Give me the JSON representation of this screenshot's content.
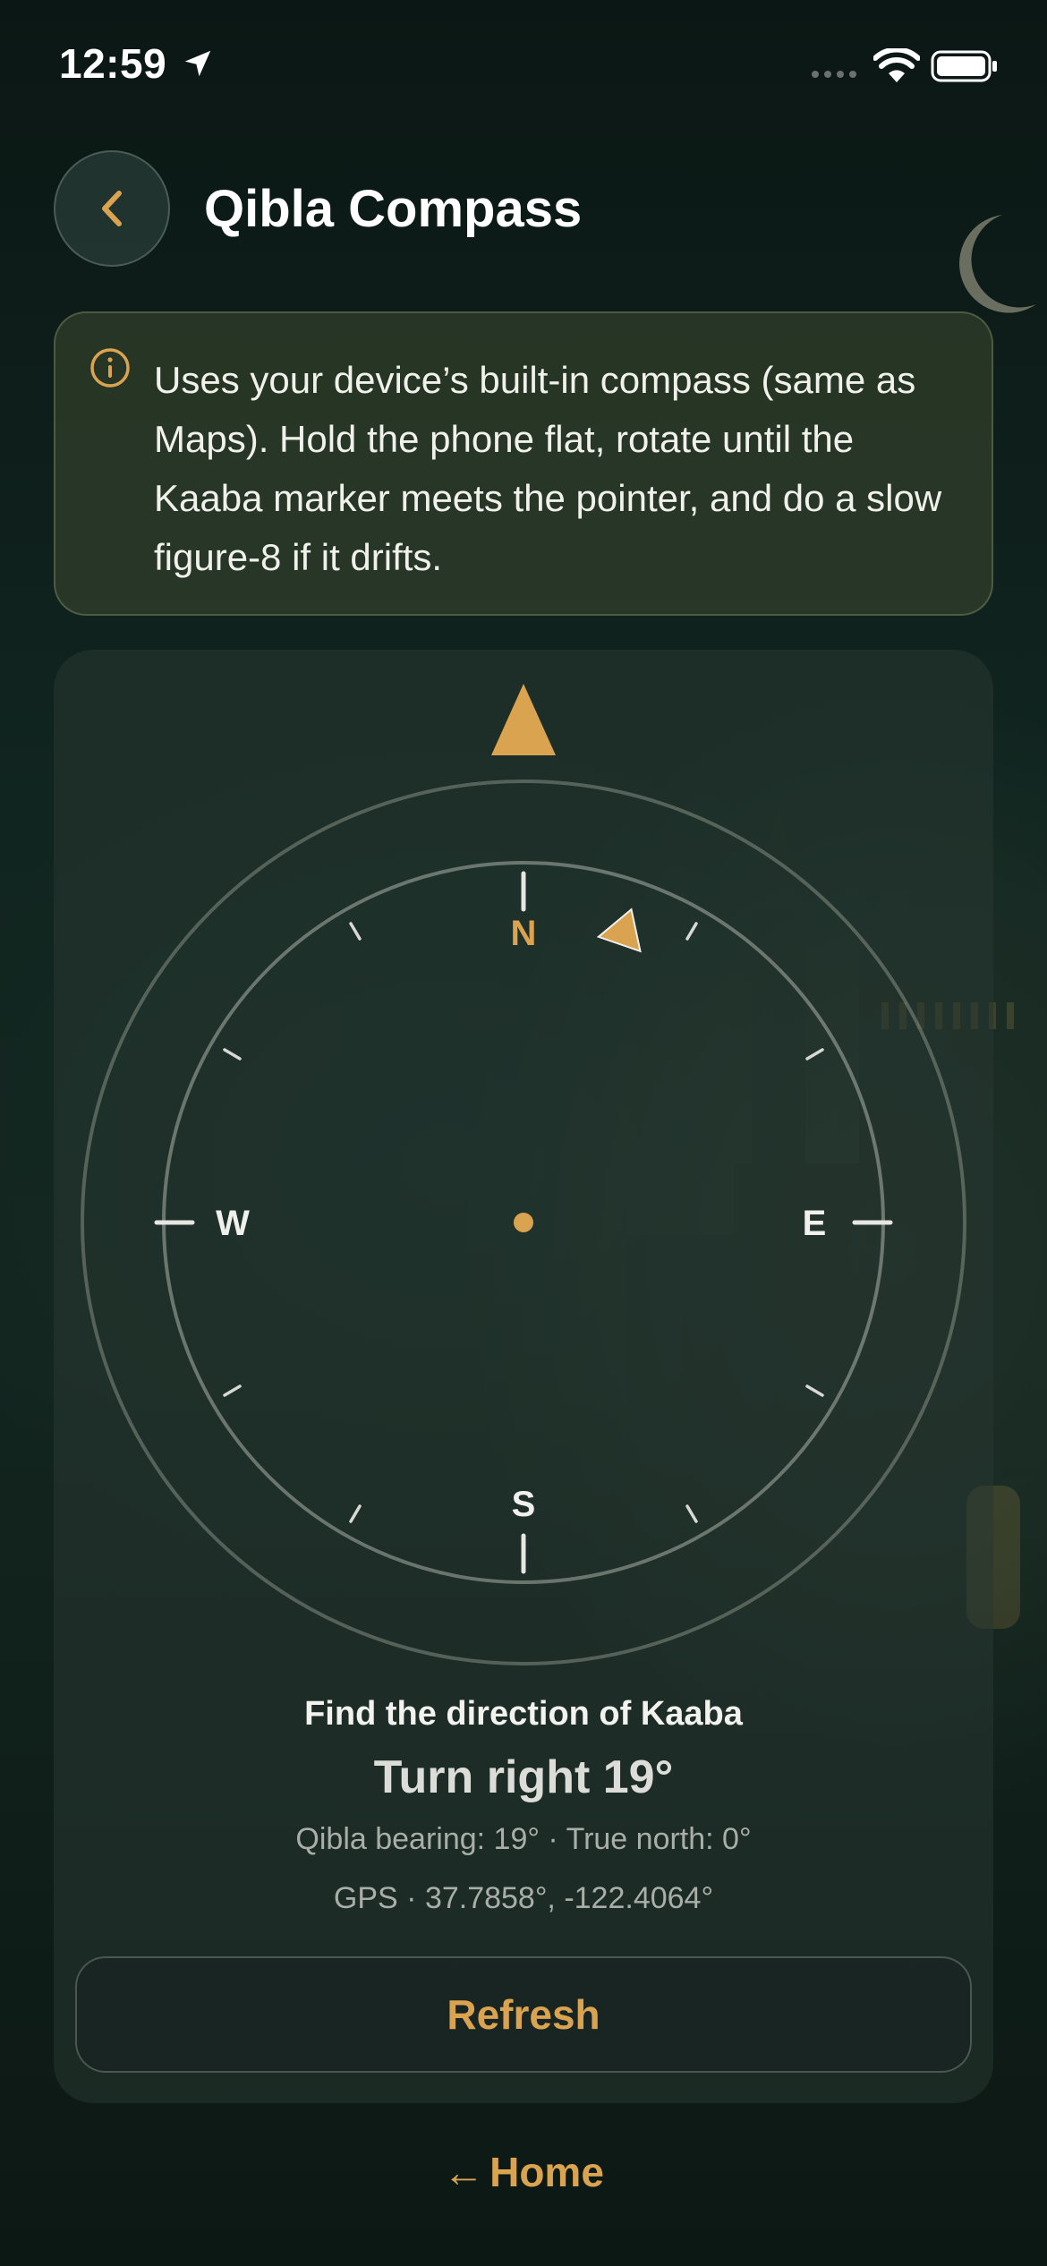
{
  "status_bar": {
    "time": "12:59"
  },
  "header": {
    "title": "Qibla Compass"
  },
  "info_card": {
    "text": "Uses your device’s built-in compass (same as Maps). Hold the phone flat, rotate until the Kaaba marker meets the pointer, and do a slow figure-8 if it drifts."
  },
  "compass": {
    "directions": {
      "north": "N",
      "south": "S",
      "east": "E",
      "west": "W"
    },
    "qibla_bearing_deg": 19,
    "heading_deg": 0
  },
  "readout": {
    "find_title": "Find the direction of Kaaba",
    "turn_text": "Turn right 19°",
    "bearing_text": "Qibla bearing: 19° · True north: 0°",
    "gps_text": "GPS · 37.7858°, -122.4064°"
  },
  "actions": {
    "refresh_label": "Refresh",
    "home_arrow": "←",
    "home_label": "Home"
  },
  "colors": {
    "accent": "#d9a34f",
    "background": "#0f201b",
    "card": "#28373280"
  }
}
